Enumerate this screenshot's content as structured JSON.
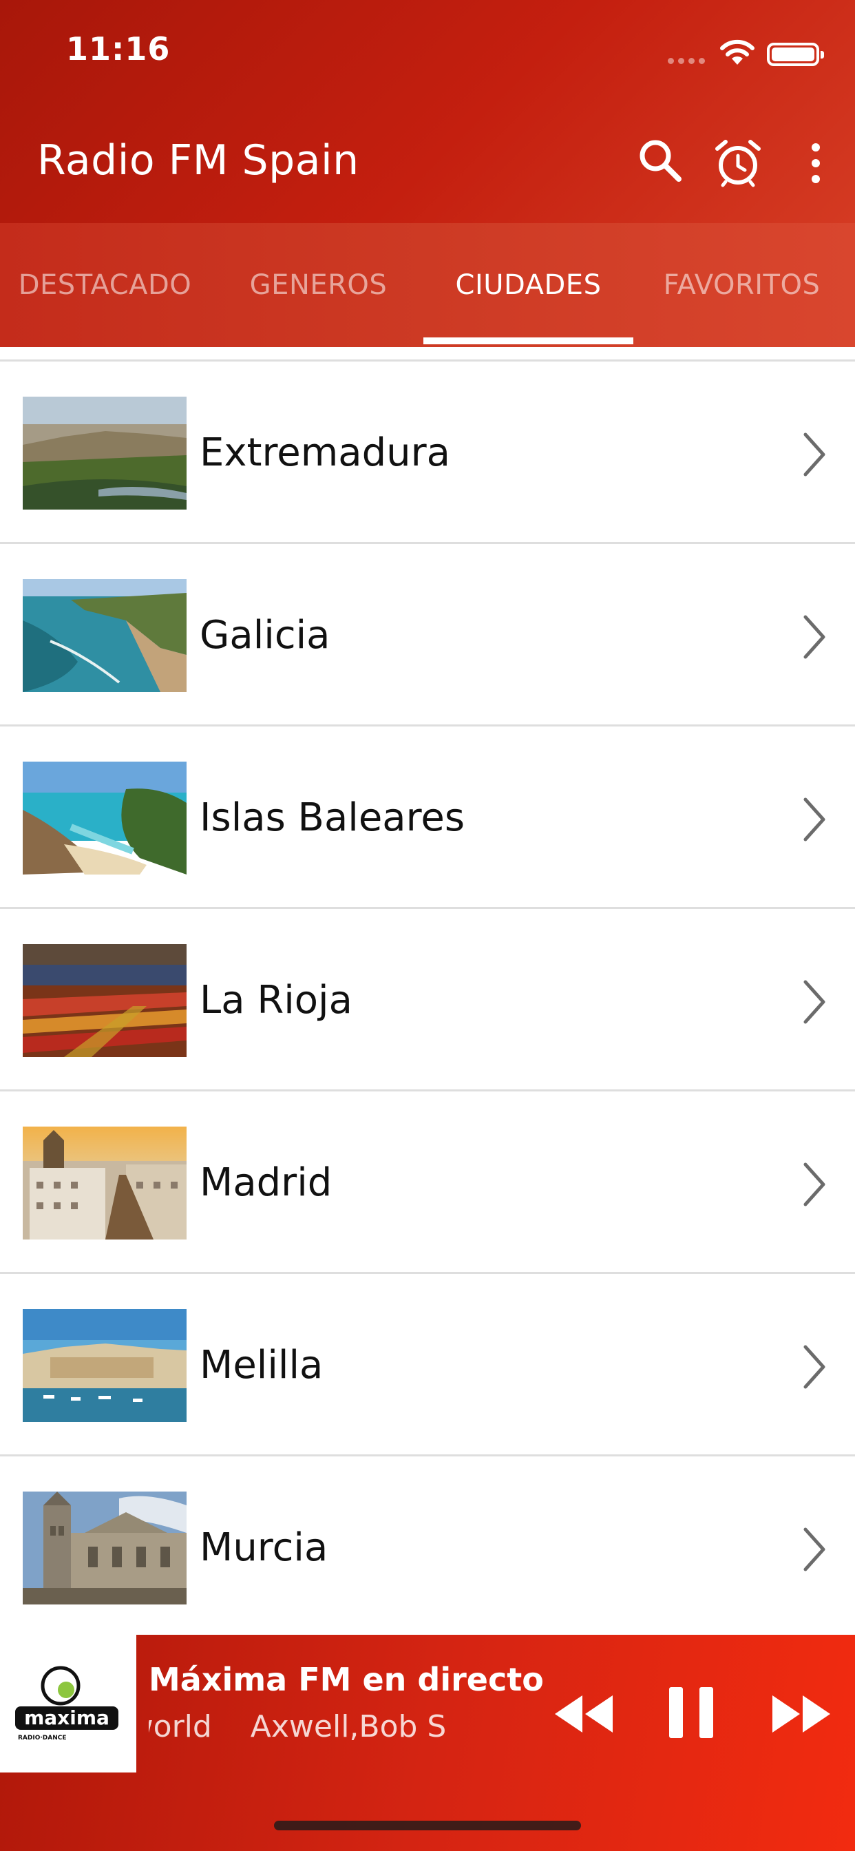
{
  "status_bar": {
    "time": "11:16"
  },
  "app_bar": {
    "title": "Radio FM Spain",
    "icons": [
      "search-icon",
      "alarm-clock-icon",
      "more-vertical-icon"
    ]
  },
  "tabs": [
    {
      "label": "DESTACADO",
      "active": false
    },
    {
      "label": "GENEROS",
      "active": false
    },
    {
      "label": "CIUDADES",
      "active": true
    },
    {
      "label": "FAVORITOS",
      "active": false
    }
  ],
  "regions": [
    {
      "label": "Extremadura"
    },
    {
      "label": "Galicia"
    },
    {
      "label": "Islas Baleares"
    },
    {
      "label": "La Rioja"
    },
    {
      "label": "Madrid"
    },
    {
      "label": "Melilla"
    },
    {
      "label": "Murcia"
    }
  ],
  "player": {
    "station": "Máxima FM en directo",
    "now_playing": "derful world    Axwell,Bob S",
    "logo_text": "maxima",
    "logo_subtext": "RADIO·DANCE",
    "controls": [
      "rewind-icon",
      "pause-icon",
      "fast-forward-icon"
    ]
  },
  "colors": {
    "header_red": "#c41f0f",
    "tab_bar_red": "#cd3a24",
    "player_red": "#e02812",
    "divider": "#dedede",
    "logo_green": "#8dc63f"
  }
}
